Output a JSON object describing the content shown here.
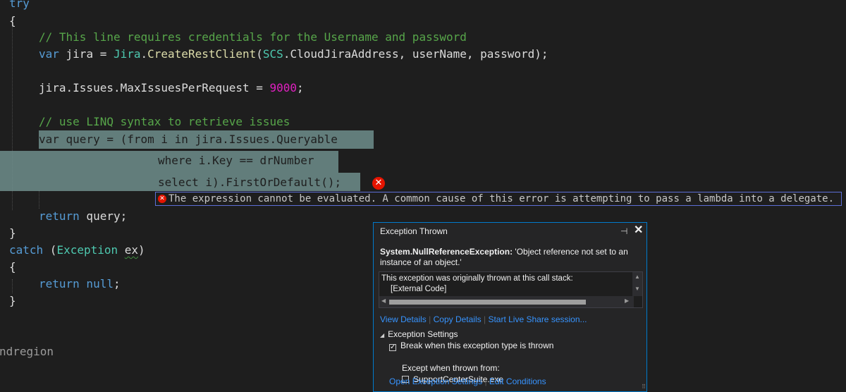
{
  "code": {
    "try_kw": "try",
    "open_brace_1": "{",
    "comment_1": "// This line requires credentials for the Username and password",
    "line_jira_var": "var",
    "line_jira_name": " jira = ",
    "line_jira_type": "Jira",
    "line_jira_dot": ".",
    "line_jira_fn": "CreateRestClient",
    "line_jira_open": "(",
    "line_jira_scs": "SCS",
    "line_jira_args": ".CloudJiraAddress, userName, password);",
    "line_max_left": "jira.Issues.MaxIssuesPerRequest = ",
    "line_max_num": "9000",
    "line_max_end": ";",
    "comment_2": "// use LINQ syntax to retrieve issues",
    "query_line_1": "var query = (from i in jira.Issues.Queryable",
    "query_line_2": "where i.Key == drNumber",
    "query_line_3": "select i).FirstOrDefault();",
    "return_kw": "return",
    "return_rest": " query;",
    "close_brace_1": "}",
    "catch_kw": "catch",
    "catch_open": " (",
    "catch_type": "Exception",
    "catch_space": " ",
    "catch_var": "ex",
    "catch_close": ")",
    "open_brace_2": "{",
    "return_null_kw": "return",
    "return_null_val": " null",
    "return_null_end": ";",
    "close_brace_2": "}",
    "endregion": "ndregion"
  },
  "error_tip": "The expression cannot be evaluated.  A common cause of this error is attempting to pass a lambda into a delegate.",
  "exception_popup": {
    "title": "Exception Thrown",
    "pin_glyph": "⊣",
    "close_glyph": "✕",
    "exception_type": "System.NullReferenceException:",
    "exception_message": " 'Object reference not set to an instance of an object.'",
    "stack_intro": "This exception was originally thrown at this call stack:",
    "stack_entry": "[External Code]",
    "links": {
      "view_details": "View Details",
      "copy_details": "Copy Details",
      "live_share": "Start Live Share session..."
    },
    "settings_header": "Exception Settings",
    "break_when_thrown": "Break when this exception type is thrown",
    "break_checked": true,
    "except_when_from": "Except when thrown from:",
    "module_name": "SupportCenterSuite.exe",
    "module_checked": false,
    "open_settings": "Open Exception Settings",
    "edit_conditions": "Edit Conditions"
  },
  "colors": {
    "editor_bg": "#1e1e1e",
    "keyword": "#569cd6",
    "type": "#4ec9b0",
    "method": "#dcdcaa",
    "number": "#b5cea8",
    "comment": "#57a64a",
    "selection": "#6f8e8c",
    "error": "#e51400",
    "popup_border": "#007acc",
    "link": "#3794ff"
  }
}
